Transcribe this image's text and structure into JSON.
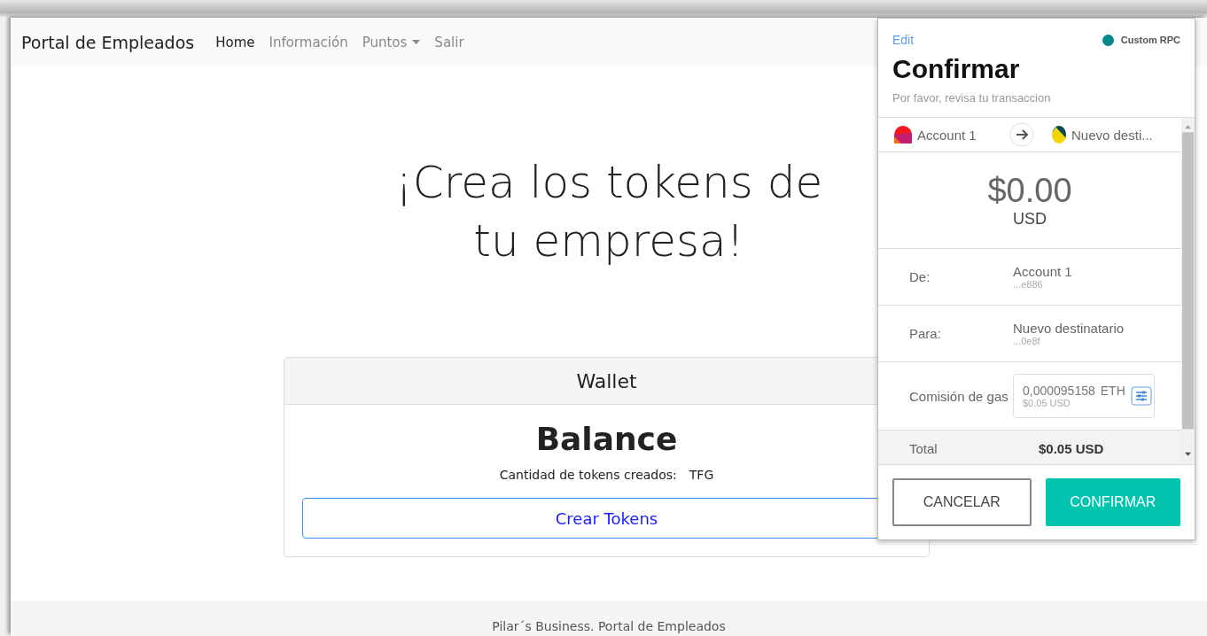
{
  "navbar": {
    "brand": "Portal de Empleados",
    "links": [
      {
        "label": "Home",
        "selected": true,
        "kind": "link"
      },
      {
        "label": "Información",
        "selected": false,
        "kind": "link"
      },
      {
        "label": "Puntos",
        "selected": false,
        "kind": "dropdown"
      },
      {
        "label": "Salir",
        "selected": false,
        "kind": "link"
      }
    ]
  },
  "hero": {
    "title_lines": [
      "¡Crea los tokens de",
      "tu empresa!"
    ]
  },
  "wallet_card": {
    "header": "Wallet",
    "title": "Balance",
    "tokens_label": "Cantidad de tokens creados:",
    "tokens_value": "TFG",
    "button": "Crear Tokens"
  },
  "footer": {
    "text": "Pilar´s Business. Portal de Empleados"
  },
  "confirm_popup": {
    "edit": "Edit",
    "network": {
      "name": "Custom RPC",
      "color": "#038789"
    },
    "title": "Confirmar",
    "subtitle": "Por favor, revisa tu transaccion",
    "from_account": "Account 1",
    "to_account": "Nuevo desti...",
    "amount": "$0.00",
    "currency": "USD",
    "details": [
      {
        "label": "De:",
        "name": "Account 1",
        "address": "...e886"
      },
      {
        "label": "Para:",
        "name": "Nuevo destinatario",
        "address": "...0e8f"
      }
    ],
    "gas": {
      "label": "Comisión de gas",
      "value": "0,000095158",
      "unit": "ETH",
      "fiat": "$0.05 USD"
    },
    "total": {
      "label": "Total",
      "value": "$0.05 USD"
    },
    "buttons": [
      {
        "label": "CANCELAR",
        "kind": "secondary"
      },
      {
        "label": "CONFIRMAR",
        "kind": "primary"
      }
    ]
  }
}
